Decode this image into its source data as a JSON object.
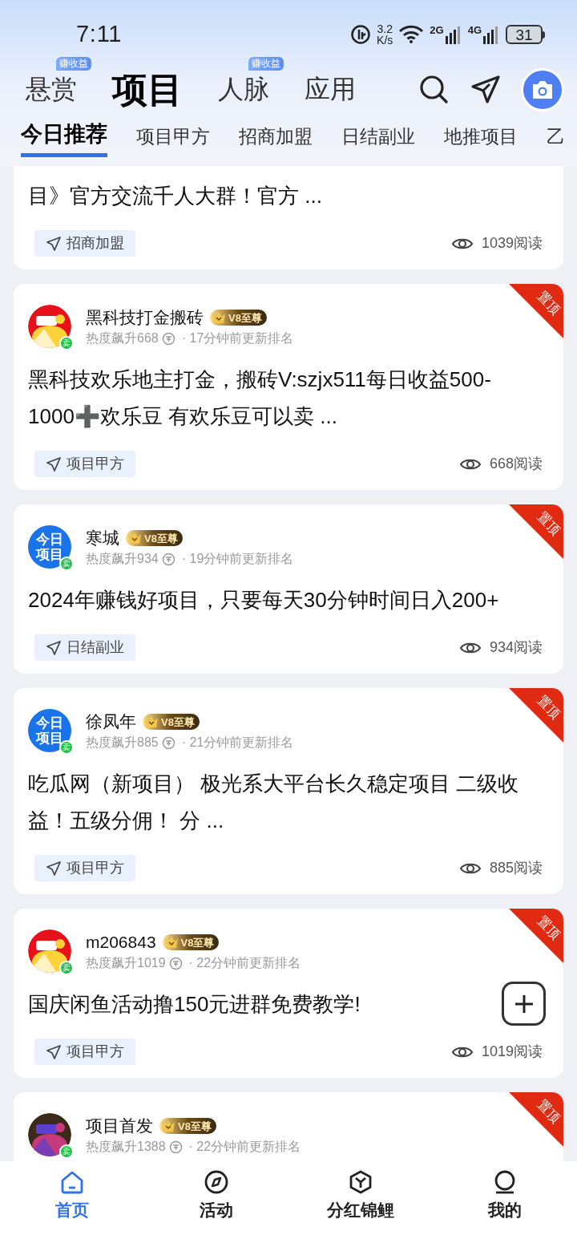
{
  "status_bar": {
    "time": "7:11",
    "speed_value": "3.2",
    "speed_unit": "K/s",
    "network_1": "2G",
    "network_2": "4G",
    "battery": "31"
  },
  "top_tabs": [
    {
      "label": "悬赏",
      "selected": false,
      "badge": "赚收益"
    },
    {
      "label": "项目",
      "selected": true
    },
    {
      "label": "人脉",
      "selected": false,
      "badge": "赚收益"
    },
    {
      "label": "应用",
      "selected": false
    }
  ],
  "sub_tabs": [
    {
      "label": "今日推荐",
      "selected": true
    },
    {
      "label": "项目甲方",
      "selected": false
    },
    {
      "label": "招商加盟",
      "selected": false
    },
    {
      "label": "日结副业",
      "selected": false
    },
    {
      "label": "地推项目",
      "selected": false
    },
    {
      "label": "乙",
      "selected": false
    }
  ],
  "posts": [
    {
      "text": "目》官方交流千人大群！官方 ...",
      "tag": "招商加盟",
      "reads": "1039阅读"
    },
    {
      "author": "黑科技打金搬砖",
      "seller_badge": "卖",
      "vip": "V8至尊",
      "heat": "热度飙升668",
      "updated": "· 17分钟前更新排名",
      "pinned": "置顶",
      "text": "黑科技欢乐地主打金，搬砖V:szjx511每日收益500-1000➕欢乐豆 有欢乐豆可以卖 ...",
      "tag": "项目甲方",
      "reads": "668阅读"
    },
    {
      "author": "寒城",
      "avatar": {
        "kind": "logo",
        "text": "今日项目"
      },
      "seller_badge": "卖",
      "vip": "V8至尊",
      "heat": "热度飙升934",
      "updated": "· 19分钟前更新排名",
      "pinned": "置顶",
      "text": "2024年赚钱好项目，只要每天30分钟时间日入200+",
      "tag": "日结副业",
      "reads": "934阅读"
    },
    {
      "author": "徐凤年",
      "avatar": {
        "kind": "logo",
        "text": "今日项目"
      },
      "seller_badge": "卖",
      "vip": "V8至尊",
      "heat": "热度飙升885",
      "updated": "· 21分钟前更新排名",
      "pinned": "置顶",
      "text": "吃瓜网（新项目） 极光系大平台长久稳定项目 二级收益！五级分佣！ 分 ...",
      "tag": "项目甲方",
      "reads": "885阅读"
    },
    {
      "author": "m206843",
      "seller_badge": "卖",
      "vip": "V8至尊",
      "heat": "热度飙升1019",
      "updated": "· 22分钟前更新排名",
      "pinned": "置顶",
      "text": "国庆闲鱼活动撸150元进群免费教学!",
      "tag": "项目甲方",
      "reads": "1019阅读"
    },
    {
      "author": "项目首发",
      "seller_badge": "卖",
      "vip": "V8至尊",
      "heat": "热度飙升1388",
      "updated": "· 22分钟前更新排名",
      "pinned": "置顶"
    }
  ],
  "bottom_nav": [
    {
      "label": "首页",
      "selected": true,
      "kind": "home"
    },
    {
      "label": "活动",
      "selected": false,
      "kind": "compass"
    },
    {
      "label": "分红锦鲤",
      "selected": false,
      "kind": "cube"
    },
    {
      "label": "我的",
      "selected": false,
      "kind": "person"
    }
  ]
}
